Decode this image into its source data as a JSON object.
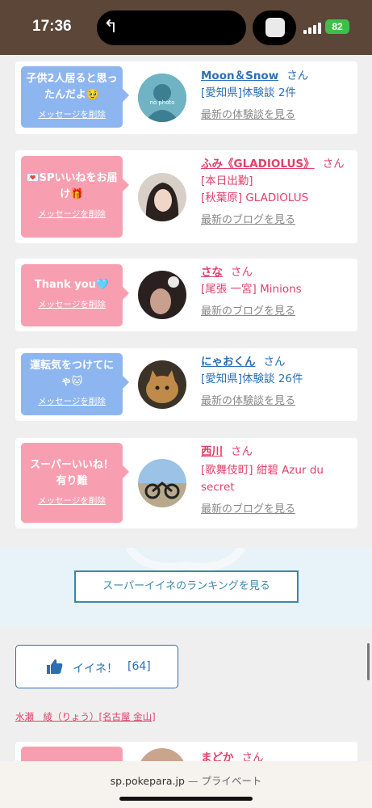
{
  "status_bar": {
    "time": "17:36",
    "battery": "82"
  },
  "cards": [
    {
      "message": "子供2人居ると思ったんだよ🥹",
      "delete_label": "メッセージを削除",
      "name": "Moon＆Snow",
      "san": "さん",
      "detail1": "[愛知県]体験談 2件",
      "detail2": "",
      "more": "最新の体験談を見る",
      "avatar_label": "no photo"
    },
    {
      "message": "💌SPいいねをお届け🎁",
      "delete_label": "メッセージを削除",
      "name": "ふみ《GLADIOLUS》",
      "san": "さん",
      "detail1": "[本日出勤]",
      "detail2": "[秋葉原] GLADIOLUS",
      "more": "最新のブログを見る"
    },
    {
      "message": "Thank you🩵",
      "delete_label": "メッセージを削除",
      "name": "さな",
      "san": "さん",
      "detail1": "[尾張 一宮] Minions",
      "detail2": "",
      "more": "最新のブログを見る"
    },
    {
      "message": "運転気をつけてにゃ🐱",
      "delete_label": "メッセージを削除",
      "name": "にゃおくん",
      "san": "さん",
      "detail1": "[愛知県]体験談 26件",
      "detail2": "",
      "more": "最新の体験談を見る"
    },
    {
      "message": "スーパーいいね！有り難",
      "delete_label": "メッセージを削除",
      "name": "西川",
      "san": "さん",
      "detail1": "[歌舞伎町] 紺碧 Azur du secret",
      "detail2": "",
      "more": "最新のブログを見る"
    },
    {
      "name": "まどか",
      "san": "さん"
    }
  ],
  "ranking_button": "スーパーイイネのランキングを見る",
  "good_button": {
    "label": "イイネ！",
    "count": "[64]"
  },
  "cast_link": "水瀬　綾（りょう）[名古屋 金山]",
  "browser": {
    "url": "sp.pokepara.jp",
    "privacy": "— プライベート"
  },
  "colors": {
    "blue": "#2a6fb5",
    "pink": "#e0406a",
    "blue_bubble": "#8db6f0",
    "pink_bubble": "#f79fb0",
    "status_bar": "#5b4637"
  }
}
